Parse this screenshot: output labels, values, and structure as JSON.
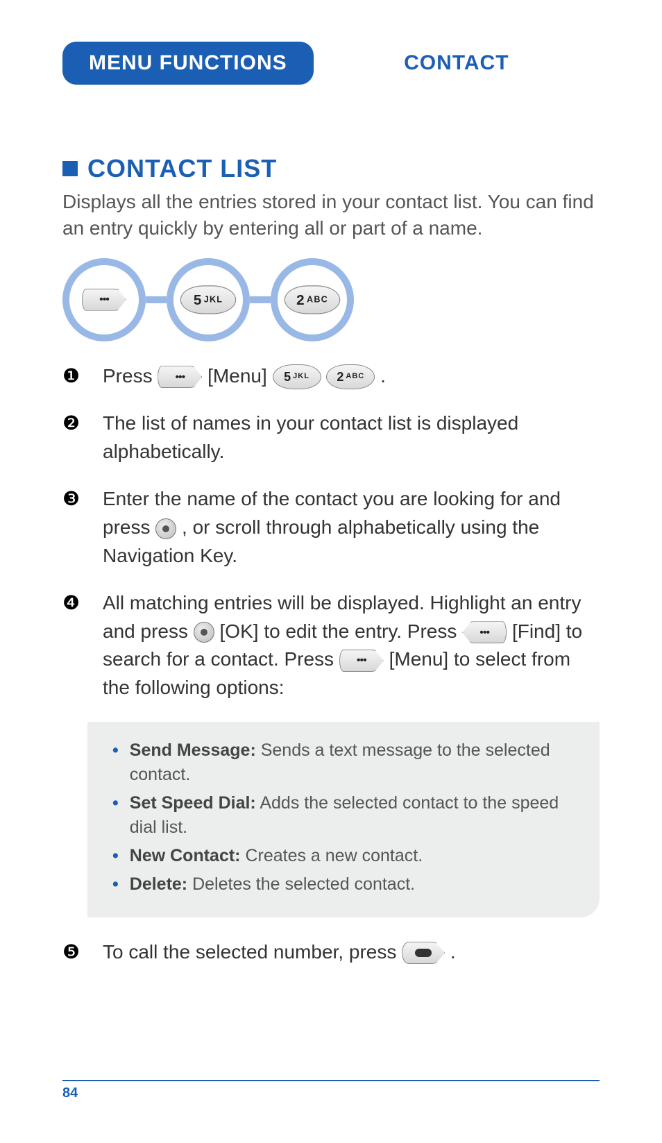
{
  "header": {
    "tab_left": "MENU FUNCTIONS",
    "tab_right": "CONTACT"
  },
  "section": {
    "title": "CONTACT LIST",
    "intro": "Displays all the entries stored in your contact list. You can find an entry quickly by entering all or part of a name."
  },
  "key_sequence": {
    "k1": {
      "type": "softkey-right"
    },
    "k2": {
      "digit": "5",
      "letters": "JKL"
    },
    "k3": {
      "digit": "2",
      "letters": "ABC"
    }
  },
  "steps": {
    "s1": {
      "num": "❶",
      "pre": "Press ",
      "menu_label": "[Menu] ",
      "key_a": {
        "digit": "5",
        "letters": "JKL"
      },
      "key_b": {
        "digit": "2",
        "letters": "ABC"
      },
      "post": " ."
    },
    "s2": {
      "num": "❷",
      "text": "The list of names in your contact list is displayed alphabetically."
    },
    "s3": {
      "num": "❸",
      "part1": "Enter the name of the contact you are looking for and press ",
      "part2": " , or scroll through alphabetically using the Navigation Key."
    },
    "s4": {
      "num": "❹",
      "part1": "All matching entries will be displayed. Highlight an entry and press ",
      "ok_label": " [OK] to edit the entry. Press ",
      "find_label": " [Find] to search for a contact. Press ",
      "part4": " [Menu] to select from the following options:"
    },
    "s5": {
      "num": "❺",
      "part1": "To call the selected number, press ",
      "part2": " ."
    }
  },
  "options": [
    {
      "label": "Send Message:",
      "desc": " Sends a text message to the selected contact."
    },
    {
      "label": "Set Speed Dial:",
      "desc": " Adds the selected contact to the speed dial list."
    },
    {
      "label": "New Contact:",
      "desc": " Creates a new contact."
    },
    {
      "label": "Delete:",
      "desc": " Deletes the selected contact."
    }
  ],
  "footer": {
    "page": "84"
  }
}
